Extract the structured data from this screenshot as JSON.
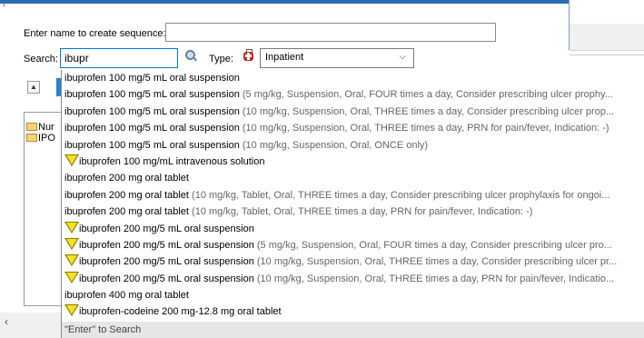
{
  "form": {
    "name_label": "Enter name to create sequence:",
    "name_value": "",
    "search_label": "Search:",
    "search_value": "ibupr",
    "type_label": "Type:",
    "type_value": "Inpatient"
  },
  "tree": {
    "items": [
      "Nur",
      "IPO"
    ]
  },
  "results": [
    {
      "name": "ibuprofen 100 mg/5 mL oral suspension",
      "detail": "",
      "warn": false
    },
    {
      "name": "ibuprofen 100 mg/5 mL oral suspension",
      "detail": "(5 mg/kg, Suspension, Oral, FOUR times a day, Consider prescribing ulcer prophy...",
      "warn": false
    },
    {
      "name": "ibuprofen 100 mg/5 mL oral suspension",
      "detail": "(10 mg/kg, Suspension, Oral, THREE times a day, Consider prescribing ulcer prop...",
      "warn": false
    },
    {
      "name": "ibuprofen 100 mg/5 mL oral suspension",
      "detail": "(10 mg/kg, Suspension, Oral, THREE times a day, PRN for pain/fever, Indication: -)",
      "warn": false
    },
    {
      "name": "ibuprofen 100 mg/5 mL oral suspension",
      "detail": "(10 mg/kg, Suspension, Oral, ONCE only)",
      "warn": false
    },
    {
      "name": "ibuprofen 100 mg/mL intravenous solution",
      "detail": "",
      "warn": true
    },
    {
      "name": "ibuprofen 200 mg oral tablet",
      "detail": "",
      "warn": false
    },
    {
      "name": "ibuprofen 200 mg oral tablet",
      "detail": "(10 mg/kg, Tablet, Oral, THREE times a day, Consider prescribing ulcer prophylaxis for ongoi...",
      "warn": false
    },
    {
      "name": "ibuprofen 200 mg oral tablet",
      "detail": "(10 mg/kg, Tablet, Oral, THREE times a day, PRN for pain/fever, Indication: -)",
      "warn": false
    },
    {
      "name": "ibuprofen 200 mg/5 mL oral suspension",
      "detail": "",
      "warn": true
    },
    {
      "name": "ibuprofen 200 mg/5 mL oral suspension",
      "detail": "(5 mg/kg, Suspension, Oral, FOUR times a day, Consider prescribing ulcer pro...",
      "warn": true
    },
    {
      "name": "ibuprofen 200 mg/5 mL oral suspension",
      "detail": "(10 mg/kg, Suspension, Oral, THREE times a day, Consider prescribing ulcer pr...",
      "warn": true
    },
    {
      "name": "ibuprofen 200 mg/5 mL oral suspension",
      "detail": "(10 mg/kg, Suspension, Oral, THREE times a day, PRN for pain/fever, Indicatio...",
      "warn": true
    },
    {
      "name": "ibuprofen 400 mg oral tablet",
      "detail": "",
      "warn": false
    },
    {
      "name": "ibuprofen-codeine 200 mg-12.8 mg oral tablet",
      "detail": "",
      "warn": true
    }
  ],
  "footer_hint": "\"Enter\" to Search",
  "icons": {
    "search": "magnifier-icon",
    "type": "medical-kit-icon",
    "warning": "warning-triangle-icon",
    "folder": "folder-icon"
  },
  "colors": {
    "accent": "#2b6cb5",
    "focus_border": "#0078d7",
    "detail_text": "#666666",
    "warning": "#e7d51c"
  }
}
